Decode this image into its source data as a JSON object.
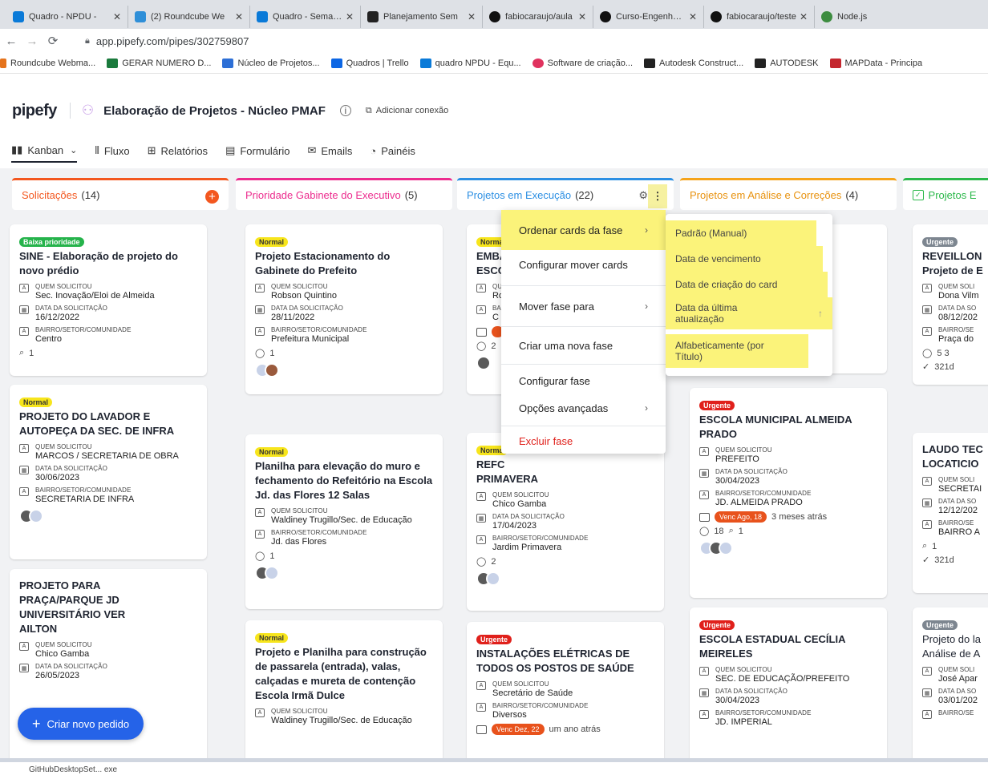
{
  "browser": {
    "tabs": [
      {
        "title": "Quadro - NPDU -",
        "icon_color": "#0a7ad8"
      },
      {
        "title": "(2) Roundcube We",
        "icon_color": "#2f8fd8"
      },
      {
        "title": "Quadro - Semana",
        "icon_color": "#0a7ad8"
      },
      {
        "title": "Planejamento Sem",
        "icon_color": "#222222"
      },
      {
        "title": "fabiocaraujo/aula",
        "icon_color": "#111111"
      },
      {
        "title": "Curso-Engenheiro",
        "icon_color": "#111111"
      },
      {
        "title": "fabiocaraujo/teste",
        "icon_color": "#111111"
      },
      {
        "title": "Node.js",
        "icon_color": "#3d8c40"
      }
    ],
    "url": "app.pipefy.com/pipes/302759807",
    "bookmarks": [
      {
        "label": "Roundcube Webma...",
        "icon_color": "#e5731c"
      },
      {
        "label": "GERAR NUMERO D...",
        "icon_color": "#1a7a3c"
      },
      {
        "label": "Núcleo de Projetos...",
        "icon_color": "#2d6fd6"
      },
      {
        "label": "Quadros | Trello",
        "icon_color": "#0c66e4"
      },
      {
        "label": "quadro NPDU - Equ...",
        "icon_color": "#0a7ad8"
      },
      {
        "label": "Software de criação...",
        "icon_color": "#e0325e"
      },
      {
        "label": "Autodesk Construct...",
        "icon_color": "#222222"
      },
      {
        "label": "AUTODESK",
        "icon_color": "#222222"
      },
      {
        "label": "MAPData - Principa",
        "icon_color": "#c4262e"
      }
    ]
  },
  "app": {
    "logo": "pipefy",
    "pipe_title": "Elaboração de Projetos - Núcleo PMAF",
    "info_label": "i",
    "add_connection": "Adicionar conexão"
  },
  "view_tabs": {
    "kanban": "Kanban",
    "fluxo": "Fluxo",
    "relatorios": "Relatórios",
    "formulario": "Formulário",
    "emails": "Emails",
    "paineis": "Painéis"
  },
  "columns": [
    {
      "name": "Solicitações",
      "count": "(14)",
      "color": "#f3571f"
    },
    {
      "name": "Prioridade Gabinete do Executivo",
      "count": "(5)",
      "color": "#ec2c8e"
    },
    {
      "name": "Projetos em Execução",
      "count": "(22)",
      "color": "#2c8fe3"
    },
    {
      "name": "Projetos em Análise e Correções",
      "count": "(4)",
      "color": "#f5a31a"
    },
    {
      "name": "Projetos E",
      "count": "",
      "color": "#2bb84a"
    }
  ],
  "field_labels": {
    "quem": "QUEM SOLICITOU",
    "data": "DATA DA SOLICITAÇÃO",
    "bairro": "BAIRRO/SETOR/COMUNIDADE"
  },
  "cards": {
    "c1": {
      "badge": "Baixa prioridade",
      "title": "SINE - Elaboração de projeto do novo prédio",
      "quem": "Sec. Inovação/Eloi de Almeida",
      "data": "16/12/2022",
      "bairro": "Centro",
      "attach": "1"
    },
    "c2": {
      "badge": "Normal",
      "title": "PROJETO DO LAVADOR E AUTOPEÇA DA SEC. DE INFRA",
      "quem": "MARCOS / SECRETARIA DE OBRA",
      "data": "30/06/2023",
      "bairro": "SECRETARIA DE INFRA"
    },
    "c3": {
      "title": "PROJETO PARA PRAÇA/PARQUE JD UNIVERSITÁRIO VER AILTON",
      "quem": "Chico Gamba",
      "data": "26/05/2023"
    },
    "c4": {
      "badge": "Normal",
      "title": "Projeto Estacionamento do Gabinete do Prefeito",
      "quem": "Robson Quintino",
      "data": "28/11/2022",
      "bairro": "Prefeitura Municipal",
      "comments": "1"
    },
    "c5": {
      "badge": "Normal",
      "title": "Planilha para elevação do muro e fechamento do Refeitório na Escola Jd. das Flores 12 Salas",
      "quem": "Waldiney Trugillo/Sec. de Educação",
      "bairro": "Jd. das Flores",
      "comments": "1"
    },
    "c6": {
      "badge": "Normal",
      "title": "Projeto e Planilha para construção de passarela (entrada), valas, calçadas e mureta de contenção Escola Irmã Dulce",
      "quem": "Waldiney Trugillo/Sec. de Educação"
    },
    "c7": {
      "badge": "Norma",
      "title": "EMBA",
      "title2": "ESCO",
      "q": "Qu",
      "qv": "Ro",
      "b": "BA",
      "bv": "C",
      "comments": "2"
    },
    "c8": {
      "badge": "Norma",
      "title": "REFC",
      "title2": "PRIMAVERA",
      "quem": "Chico Gamba",
      "data": "17/04/2023",
      "bairro": "Jardim Primavera",
      "comments": "2"
    },
    "c9": {
      "badge": "Urgente",
      "title": "INSTALAÇÕES ELÉTRICAS DE TODOS OS POSTOS DE SAÚDE",
      "quem": "Secretário de Saúde",
      "bairro": "Diversos",
      "venc": "Venc Dez, 22",
      "ago": "um ano atrás"
    },
    "c10": {
      "badge": "Urgente",
      "title": "ESCOLA MUNICIPAL ALMEIDA PRADO",
      "quem": "PREFEITO",
      "data": "30/04/2023",
      "bairro": "JD. ALMEIDA PRADO",
      "venc": "Venc Ago, 18",
      "ago": "3 meses atrás",
      "comments": "18",
      "attach": "1"
    },
    "c11": {
      "badge": "Urgente",
      "title": "ESCOLA ESTADUAL CECÍLIA MEIRELES",
      "quem": "SEC. DE EDUCAÇÃO/PREFEITO",
      "data": "30/04/2023",
      "bairro": "JD. IMPERIAL"
    },
    "c12": {
      "badge": "Urgente",
      "title": "REVEILLON",
      "title2": "Projeto de E",
      "quem": "Dona Vilm",
      "data": "08/12/202",
      "bairro": "Praça do",
      "meta": "5  3",
      "days": "321d"
    },
    "c13": {
      "title": "LAUDO TEC",
      "title2": "LOCATICIO",
      "quem": "SECRETAI",
      "data": "12/12/202",
      "bairro": "BAIRRO A",
      "attach": "1",
      "days": "321d"
    },
    "c14": {
      "badge": "Urgente",
      "title": "Projeto do la",
      "title2": "Análise de A",
      "quem": "José Apar",
      "data": "03/01/202",
      "labels": {
        "quem": "QUEM SOLI",
        "data": "DATA DA SO",
        "bairro": "BAIRRO/SE"
      }
    }
  },
  "fab_label": "Criar novo pedido",
  "context_menu": {
    "items": [
      "Ordenar cards da fase",
      "Configurar mover cards",
      "Mover fase para",
      "Criar uma nova fase",
      "Configurar fase",
      "Opções avançadas",
      "Excluir fase"
    ],
    "danger_color": "#e0201b"
  },
  "sort_submenu": {
    "items": [
      "Padrão (Manual)",
      "Data de vencimento",
      "Data de criação do card",
      "Data da última atualização",
      "Alfabeticamente (por Título)"
    ]
  },
  "taskbar_text": "GitHubDesktopSet... exe"
}
